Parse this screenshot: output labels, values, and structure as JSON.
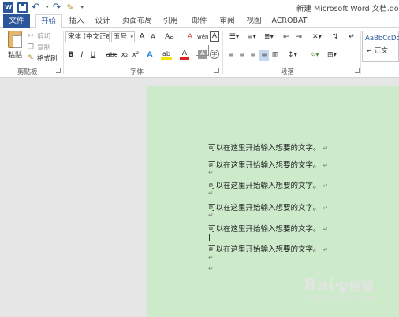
{
  "titlebar": {
    "title": "新建 Microsoft Word 文档.docx -",
    "word_logo": "W"
  },
  "tabs": [
    "文件",
    "开始",
    "插入",
    "设计",
    "页面布局",
    "引用",
    "邮件",
    "审阅",
    "视图",
    "ACROBAT"
  ],
  "clipboard": {
    "paste": "粘贴",
    "cut": "剪切",
    "copy": "复制",
    "format_painter": "格式刷",
    "group_label": "剪贴板"
  },
  "font": {
    "font_name": "宋体 (中文正文",
    "font_size": "五号",
    "grow": "A",
    "shrink": "A",
    "change_case": "Aa",
    "clear": "A",
    "phonetic": "wén",
    "border": "A",
    "bold": "B",
    "italic": "I",
    "underline": "U",
    "strike": "abc",
    "subscript": "x₂",
    "superscript": "x²",
    "effects": "A",
    "highlight": "ab",
    "color": "A",
    "shading": "A",
    "enclose": "字",
    "group_label": "字体"
  },
  "paragraph": {
    "group_label": "段落"
  },
  "styles": {
    "sample": "AaBbCcDd",
    "name": "↵ 正文"
  },
  "document": {
    "lines": [
      "可以在这里开始输入想要的文字。",
      "可以在这里开始输入想要的文字。",
      "可以在这里开始输入想要的文字。",
      "可以在这里开始输入想要的文字。",
      "可以在这里开始输入想要的文字。",
      "可以在这里开始输入想要的文字。"
    ],
    "para_mark": "↵"
  },
  "watermark": {
    "main": "Bai",
    "suffix": "经验",
    "url": "jingyan.baidu.com"
  },
  "colors": {
    "accent": "#2b579a",
    "page_bg": "#cdebcb",
    "workspace_bg": "#e6e6e6",
    "font_color_red": "#e02020",
    "highlight_yellow": "#f5e500"
  }
}
